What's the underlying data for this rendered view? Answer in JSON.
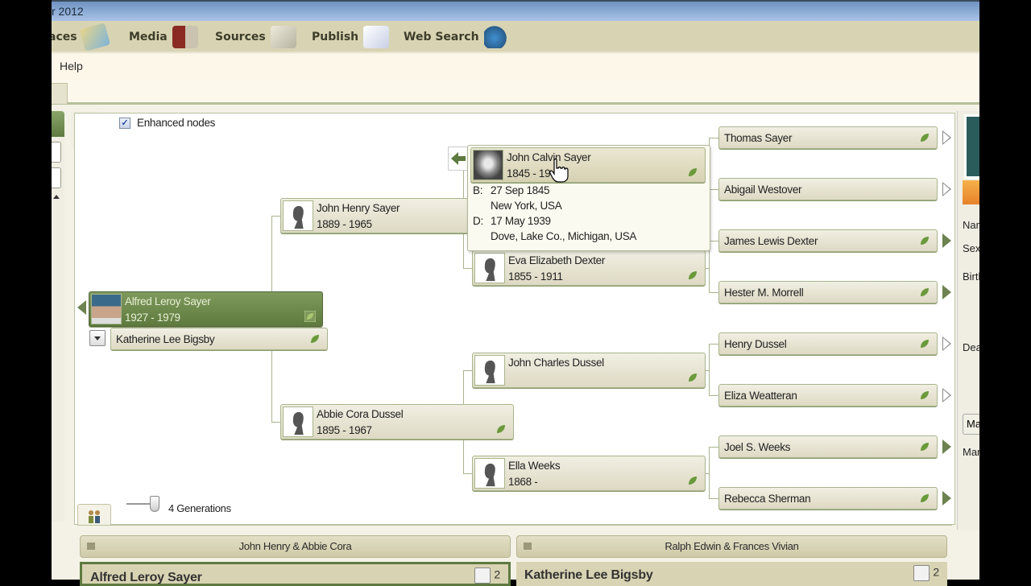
{
  "window": {
    "title": "r 2012"
  },
  "toolbar": {
    "items": [
      {
        "label": "aces",
        "icon": "places-map-icon"
      },
      {
        "label": "Media",
        "icon": "media-books-icon"
      },
      {
        "label": "Sources",
        "icon": "sources-scroll-icon"
      },
      {
        "label": "Publish",
        "icon": "publish-book-icon"
      },
      {
        "label": "Web Search",
        "icon": "web-search-binoculars-icon"
      }
    ]
  },
  "menubar": {
    "items": [
      {
        "label": "Help"
      }
    ]
  },
  "pedigree": {
    "enhanced_nodes_label": "Enhanced nodes",
    "enhanced_nodes_checked": true,
    "generations_label": "4 Generations",
    "generations_value": 4,
    "root": {
      "name": "Alfred Leroy Sayer",
      "years": "1927 - 1979"
    },
    "spouse": {
      "name": "Katherine Lee Bigsby"
    },
    "gen2": [
      {
        "name": "John Henry Sayer",
        "years": "1889 - 1965"
      },
      {
        "name": "Abbie Cora Dussel",
        "years": "1895 - 1967"
      }
    ],
    "gen3": [
      {
        "name": "John Calvin Sayer",
        "years": "1845 - 19"
      },
      {
        "name": "Eva Elizabeth Dexter",
        "years": "1855 - 1911"
      },
      {
        "name": "John Charles Dussel",
        "years": ""
      },
      {
        "name": "Ella Weeks",
        "years": "1868 -"
      }
    ],
    "gen4": [
      {
        "name": "Thomas Sayer",
        "has_leaf": true,
        "expand": "hollow"
      },
      {
        "name": "Abigail Westover",
        "has_leaf": false,
        "expand": "hollow"
      },
      {
        "name": "James Lewis Dexter",
        "has_leaf": true,
        "expand": "filled"
      },
      {
        "name": "Hester M. Morrell",
        "has_leaf": true,
        "expand": "filled"
      },
      {
        "name": "Henry Dussel",
        "has_leaf": true,
        "expand": "hollow"
      },
      {
        "name": "Eliza Weatteran",
        "has_leaf": true,
        "expand": "hollow"
      },
      {
        "name": "Joel S. Weeks",
        "has_leaf": true,
        "expand": "filled"
      },
      {
        "name": "Rebecca Sherman",
        "has_leaf": true,
        "expand": "filled"
      }
    ],
    "popup": {
      "birth_label": "B:",
      "birth_date": "27 Sep 1845",
      "birth_place": "New York, USA",
      "death_label": "D:",
      "death_date": "17 May 1939",
      "death_place": "Dove, Lake Co., Michigan, USA"
    }
  },
  "families": {
    "left": {
      "parents": "John Henry & Abbie Cora",
      "person": "Alfred Leroy Sayer",
      "count": "2"
    },
    "right": {
      "parents": "Ralph Edwin & Frances Vivian",
      "person": "Katherine Lee Bigsby",
      "count": "2"
    }
  },
  "right_panel": {
    "labels": [
      "Nam",
      "Sex",
      "Birth",
      "Dea",
      "Mar"
    ],
    "marriage_button": "Ma"
  },
  "colors": {
    "accent_green": "#5e7a3e",
    "node_border": "#a9b58c",
    "toolbar_bg": "#d8d3b2"
  }
}
